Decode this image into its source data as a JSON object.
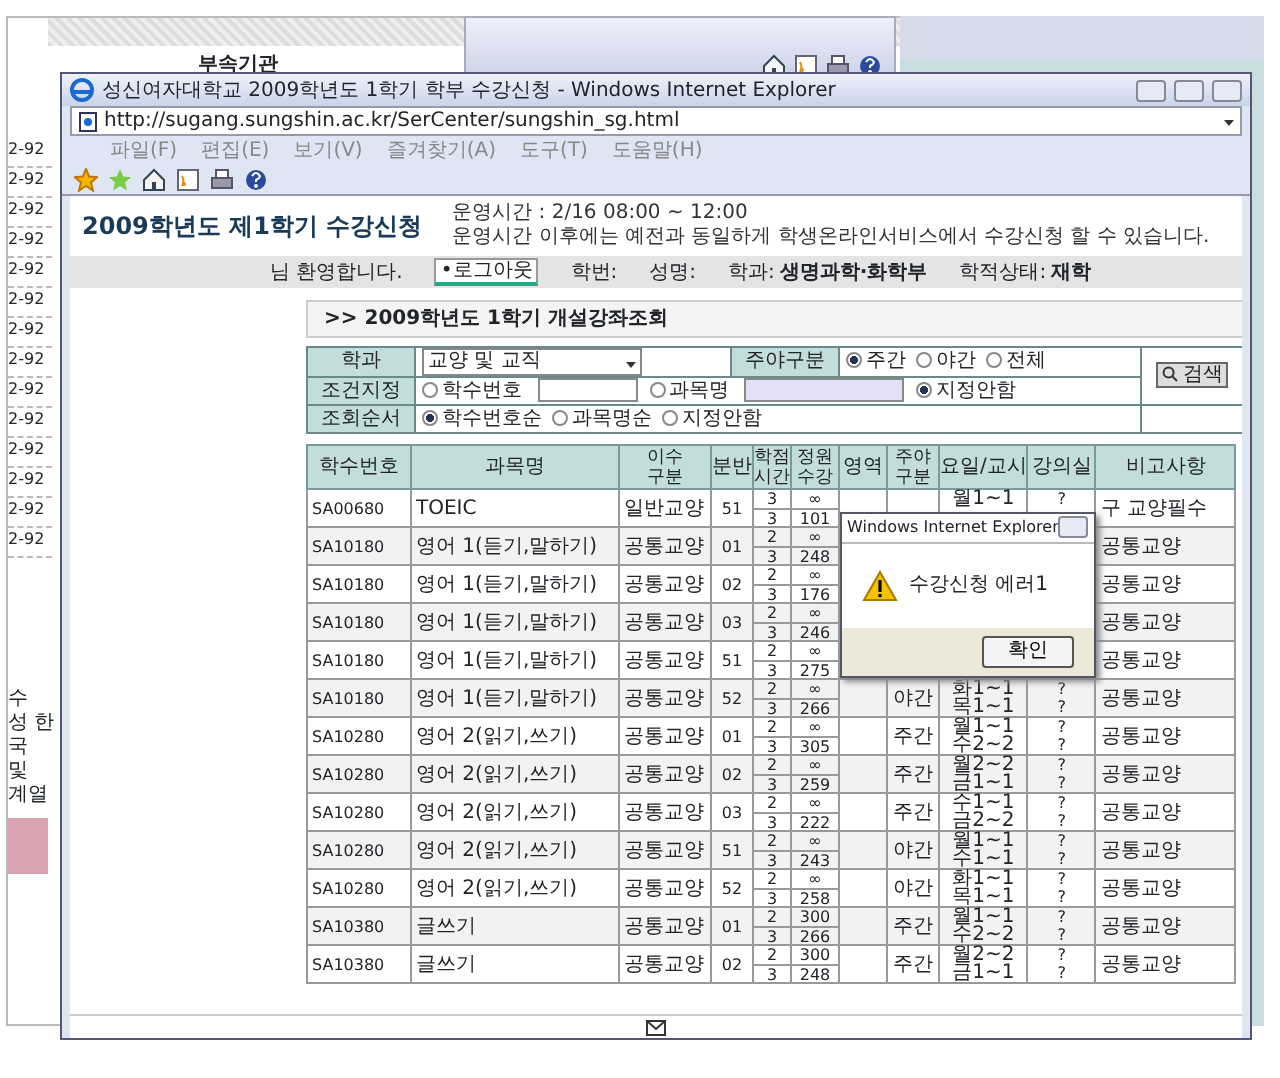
{
  "background_window": {
    "heading": "부속기관",
    "list_items": [
      "2-92",
      "2-92",
      "2-92",
      "2-92",
      "2-92",
      "2-92",
      "2-92",
      "2-92",
      "2-92",
      "2-92",
      "2-92",
      "2-92",
      "2-92",
      "2-92"
    ],
    "side_texts": [
      "수",
      "성 한",
      "국",
      "및",
      "계열"
    ]
  },
  "browser": {
    "title": "성신여자대학교 2009학년도 1학기 학부 수강신청 - Windows Internet Explorer",
    "address": "http://sugang.sungshin.ac.kr/SerCenter/sungshin_sg.html",
    "menu": [
      "파일(F)",
      "편집(E)",
      "보기(V)",
      "즐겨찾기(A)",
      "도구(T)",
      "도움말(H)"
    ]
  },
  "page": {
    "title": "2009학년도 제1학기 수강신청",
    "notice": [
      "운영시간 : 2/16 08:00 ~ 12:00",
      "운영시간 이후에는 예전과 동일하게 학생온라인서비스에서 수강신청 할 수 있습니다."
    ],
    "welcome": "님 환영합니다.",
    "logout": "•로그아웃",
    "info": [
      {
        "label": "학번:"
      },
      {
        "label": "성명:"
      },
      {
        "label": "학과:",
        "value": "생명과학·화학부"
      },
      {
        "label": "학적상태:",
        "value": "재학"
      }
    ],
    "section_title": ">> 2009학년도 1학기 개설강좌조회",
    "filters": [
      {
        "label": "학과",
        "select": "교양 및 교직",
        "label2": "주야구분",
        "options": [
          {
            "label": "주간",
            "selected": true
          },
          {
            "label": "야간",
            "selected": false
          },
          {
            "label": "전체",
            "selected": false
          }
        ]
      },
      {
        "label": "조건지정",
        "options": [
          {
            "label": "학수번호",
            "selected": false,
            "field": true
          },
          {
            "label": "과목명",
            "selected": false,
            "field": true
          },
          {
            "label": "지정안함",
            "selected": true
          }
        ]
      },
      {
        "label": "조회순서",
        "options": [
          {
            "label": "학수번호순",
            "selected": true
          },
          {
            "label": "과목명순",
            "selected": false
          },
          {
            "label": "지정안함",
            "selected": false
          }
        ]
      }
    ],
    "search_button": "검색",
    "columns": [
      [
        "학수번호"
      ],
      [
        "과목명"
      ],
      [
        "이수",
        "구분"
      ],
      [
        "분반"
      ],
      [
        "학점",
        "시간"
      ],
      [
        "정원",
        "수강"
      ],
      [
        "영역"
      ],
      [
        "주야",
        "구분"
      ],
      [
        "요일/교시"
      ],
      [
        "강의실"
      ],
      [
        "비고사항"
      ]
    ],
    "rows": [
      {
        "code": "SA00680",
        "name": "TOEIC",
        "type": "일반교양",
        "section": "51",
        "credit": "3",
        "hours": "3",
        "capacity": "∞",
        "enrolled": "101",
        "times": [
          "월1~1"
        ],
        "rooms": [
          "?"
        ],
        "note": "구 교양필수"
      },
      {
        "code": "SA10180",
        "name": "영어 1(듣기,말하기)",
        "type": "공통교양",
        "section": "01",
        "credit": "2",
        "hours": "3",
        "capacity": "∞",
        "enrolled": "248",
        "note": "공통교양"
      },
      {
        "code": "SA10180",
        "name": "영어 1(듣기,말하기)",
        "type": "공통교양",
        "section": "02",
        "credit": "2",
        "hours": "3",
        "capacity": "∞",
        "enrolled": "176",
        "note": "공통교양"
      },
      {
        "code": "SA10180",
        "name": "영어 1(듣기,말하기)",
        "type": "공통교양",
        "section": "03",
        "credit": "2",
        "hours": "3",
        "capacity": "∞",
        "enrolled": "246",
        "note": "공통교양"
      },
      {
        "code": "SA10180",
        "name": "영어 1(듣기,말하기)",
        "type": "공통교양",
        "section": "51",
        "credit": "2",
        "hours": "3",
        "capacity": "∞",
        "enrolled": "275",
        "note": "공통교양"
      },
      {
        "code": "SA10180",
        "name": "영어 1(듣기,말하기)",
        "type": "공통교양",
        "section": "52",
        "credit": "2",
        "hours": "3",
        "capacity": "∞",
        "enrolled": "266",
        "shift": "야간",
        "times": [
          "화1~1",
          "목1~1"
        ],
        "rooms": [
          "?",
          "?"
        ],
        "note": "공통교양"
      },
      {
        "code": "SA10280",
        "name": "영어 2(읽기,쓰기)",
        "type": "공통교양",
        "section": "01",
        "credit": "2",
        "hours": "3",
        "capacity": "∞",
        "enrolled": "305",
        "shift": "주간",
        "times": [
          "월1~1",
          "수2~2"
        ],
        "rooms": [
          "?",
          "?"
        ],
        "note": "공통교양"
      },
      {
        "code": "SA10280",
        "name": "영어 2(읽기,쓰기)",
        "type": "공통교양",
        "section": "02",
        "credit": "2",
        "hours": "3",
        "capacity": "∞",
        "enrolled": "259",
        "shift": "주간",
        "times": [
          "월2~2",
          "금1~1"
        ],
        "rooms": [
          "?",
          "?"
        ],
        "note": "공통교양"
      },
      {
        "code": "SA10280",
        "name": "영어 2(읽기,쓰기)",
        "type": "공통교양",
        "section": "03",
        "credit": "2",
        "hours": "3",
        "capacity": "∞",
        "enrolled": "222",
        "shift": "주간",
        "times": [
          "수1~1",
          "금2~2"
        ],
        "rooms": [
          "?",
          "?"
        ],
        "note": "공통교양"
      },
      {
        "code": "SA10280",
        "name": "영어 2(읽기,쓰기)",
        "type": "공통교양",
        "section": "51",
        "credit": "2",
        "hours": "3",
        "capacity": "∞",
        "enrolled": "243",
        "shift": "야간",
        "times": [
          "월1~1",
          "수1~1"
        ],
        "rooms": [
          "?",
          "?"
        ],
        "note": "공통교양"
      },
      {
        "code": "SA10280",
        "name": "영어 2(읽기,쓰기)",
        "type": "공통교양",
        "section": "52",
        "credit": "2",
        "hours": "3",
        "capacity": "∞",
        "enrolled": "258",
        "shift": "야간",
        "times": [
          "화1~1",
          "목1~1"
        ],
        "rooms": [
          "?",
          "?"
        ],
        "note": "공통교양"
      },
      {
        "code": "SA10380",
        "name": "글쓰기",
        "type": "공통교양",
        "section": "01",
        "credit": "2",
        "hours": "3",
        "capacity": "300",
        "enrolled": "266",
        "shift": "주간",
        "times": [
          "월1~1",
          "수2~2"
        ],
        "rooms": [
          "?",
          "?"
        ],
        "note": "공통교양"
      },
      {
        "code": "SA10380",
        "name": "글쓰기",
        "type": "공통교양",
        "section": "02",
        "credit": "2",
        "hours": "3",
        "capacity": "300",
        "enrolled": "248",
        "shift": "주간",
        "times": [
          "월2~2",
          "금1~1"
        ],
        "rooms": [
          "?",
          "?"
        ],
        "note": "공통교양"
      }
    ],
    "dialog": {
      "title": "Windows Internet Explorer",
      "message": "수강신청 에러1",
      "button": "확인"
    }
  }
}
